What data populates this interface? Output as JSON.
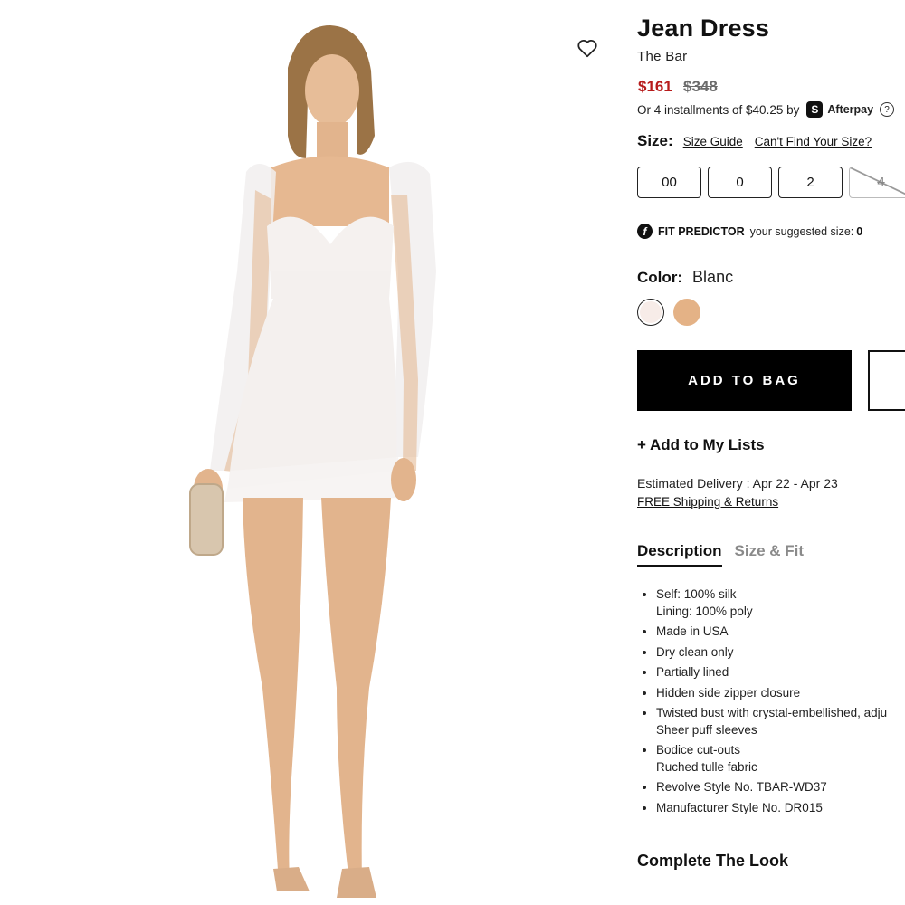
{
  "product": {
    "title": "Jean Dress",
    "brand": "The Bar",
    "price_sale": "$161",
    "price_original": "$348",
    "installments_text": "Or 4 installments of $40.25 by",
    "afterpay_label": "Afterpay",
    "afterpay_glyph": "S",
    "help_glyph": "?"
  },
  "size": {
    "label": "Size:",
    "guide_link": "Size Guide",
    "cant_find_link": "Can't Find Your Size?",
    "options": [
      {
        "label": "00",
        "available": true
      },
      {
        "label": "0",
        "available": true
      },
      {
        "label": "2",
        "available": true
      },
      {
        "label": "4",
        "available": false
      }
    ]
  },
  "fit_predictor": {
    "glyph": "f",
    "title": "FIT PREDICTOR",
    "text": "your suggested size:",
    "suggested_size": "0"
  },
  "color": {
    "label": "Color:",
    "value": "Blanc",
    "swatches": [
      {
        "name": "Blanc",
        "hex": "#f7ece8",
        "selected": true
      },
      {
        "name": "Nude",
        "hex": "#e4b286",
        "selected": false
      }
    ]
  },
  "actions": {
    "add_to_bag": "ADD TO BAG",
    "add_to_lists": "+ Add to My Lists"
  },
  "delivery": {
    "estimate": "Estimated Delivery : Apr 22 - Apr 23",
    "shipping_link": "FREE Shipping & Returns"
  },
  "tabs": [
    "Description",
    "Size & Fit"
  ],
  "description": [
    [
      "Self: 100% silk",
      "Lining: 100% poly"
    ],
    [
      "Made in USA"
    ],
    [
      "Dry clean only"
    ],
    [
      "Partially lined"
    ],
    [
      "Hidden side zipper closure"
    ],
    [
      "Twisted bust with crystal-embellished, adju",
      "Sheer puff sleeves"
    ],
    [
      "Bodice cut-outs",
      "Ruched tulle fabric"
    ],
    [
      "Revolve Style No. TBAR-WD37"
    ],
    [
      "Manufacturer Style No. DR015"
    ]
  ],
  "complete_the_look": "Complete The Look",
  "colors": {
    "sale_price": "#b71c1c",
    "button_black": "#000000"
  }
}
